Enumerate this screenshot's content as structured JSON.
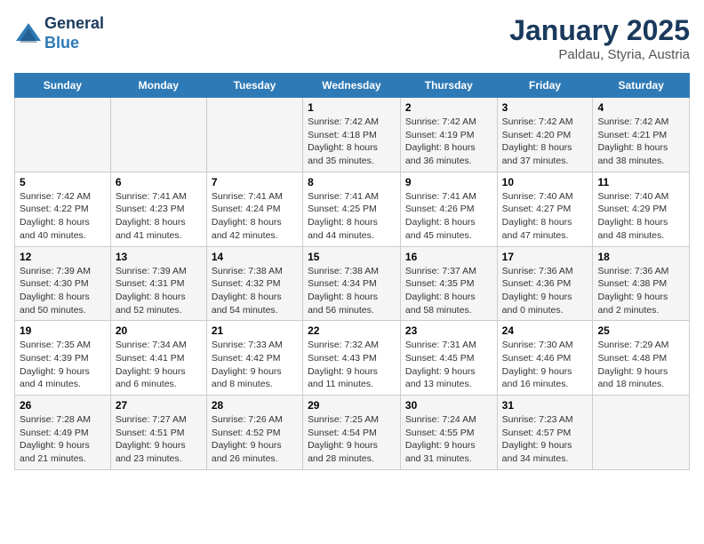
{
  "header": {
    "logo_line1": "General",
    "logo_line2": "Blue",
    "title": "January 2025",
    "subtitle": "Paldau, Styria, Austria"
  },
  "weekdays": [
    "Sunday",
    "Monday",
    "Tuesday",
    "Wednesday",
    "Thursday",
    "Friday",
    "Saturday"
  ],
  "weeks": [
    [
      {
        "day": "",
        "info": ""
      },
      {
        "day": "",
        "info": ""
      },
      {
        "day": "",
        "info": ""
      },
      {
        "day": "1",
        "info": "Sunrise: 7:42 AM\nSunset: 4:18 PM\nDaylight: 8 hours and 35 minutes."
      },
      {
        "day": "2",
        "info": "Sunrise: 7:42 AM\nSunset: 4:19 PM\nDaylight: 8 hours and 36 minutes."
      },
      {
        "day": "3",
        "info": "Sunrise: 7:42 AM\nSunset: 4:20 PM\nDaylight: 8 hours and 37 minutes."
      },
      {
        "day": "4",
        "info": "Sunrise: 7:42 AM\nSunset: 4:21 PM\nDaylight: 8 hours and 38 minutes."
      }
    ],
    [
      {
        "day": "5",
        "info": "Sunrise: 7:42 AM\nSunset: 4:22 PM\nDaylight: 8 hours and 40 minutes."
      },
      {
        "day": "6",
        "info": "Sunrise: 7:41 AM\nSunset: 4:23 PM\nDaylight: 8 hours and 41 minutes."
      },
      {
        "day": "7",
        "info": "Sunrise: 7:41 AM\nSunset: 4:24 PM\nDaylight: 8 hours and 42 minutes."
      },
      {
        "day": "8",
        "info": "Sunrise: 7:41 AM\nSunset: 4:25 PM\nDaylight: 8 hours and 44 minutes."
      },
      {
        "day": "9",
        "info": "Sunrise: 7:41 AM\nSunset: 4:26 PM\nDaylight: 8 hours and 45 minutes."
      },
      {
        "day": "10",
        "info": "Sunrise: 7:40 AM\nSunset: 4:27 PM\nDaylight: 8 hours and 47 minutes."
      },
      {
        "day": "11",
        "info": "Sunrise: 7:40 AM\nSunset: 4:29 PM\nDaylight: 8 hours and 48 minutes."
      }
    ],
    [
      {
        "day": "12",
        "info": "Sunrise: 7:39 AM\nSunset: 4:30 PM\nDaylight: 8 hours and 50 minutes."
      },
      {
        "day": "13",
        "info": "Sunrise: 7:39 AM\nSunset: 4:31 PM\nDaylight: 8 hours and 52 minutes."
      },
      {
        "day": "14",
        "info": "Sunrise: 7:38 AM\nSunset: 4:32 PM\nDaylight: 8 hours and 54 minutes."
      },
      {
        "day": "15",
        "info": "Sunrise: 7:38 AM\nSunset: 4:34 PM\nDaylight: 8 hours and 56 minutes."
      },
      {
        "day": "16",
        "info": "Sunrise: 7:37 AM\nSunset: 4:35 PM\nDaylight: 8 hours and 58 minutes."
      },
      {
        "day": "17",
        "info": "Sunrise: 7:36 AM\nSunset: 4:36 PM\nDaylight: 9 hours and 0 minutes."
      },
      {
        "day": "18",
        "info": "Sunrise: 7:36 AM\nSunset: 4:38 PM\nDaylight: 9 hours and 2 minutes."
      }
    ],
    [
      {
        "day": "19",
        "info": "Sunrise: 7:35 AM\nSunset: 4:39 PM\nDaylight: 9 hours and 4 minutes."
      },
      {
        "day": "20",
        "info": "Sunrise: 7:34 AM\nSunset: 4:41 PM\nDaylight: 9 hours and 6 minutes."
      },
      {
        "day": "21",
        "info": "Sunrise: 7:33 AM\nSunset: 4:42 PM\nDaylight: 9 hours and 8 minutes."
      },
      {
        "day": "22",
        "info": "Sunrise: 7:32 AM\nSunset: 4:43 PM\nDaylight: 9 hours and 11 minutes."
      },
      {
        "day": "23",
        "info": "Sunrise: 7:31 AM\nSunset: 4:45 PM\nDaylight: 9 hours and 13 minutes."
      },
      {
        "day": "24",
        "info": "Sunrise: 7:30 AM\nSunset: 4:46 PM\nDaylight: 9 hours and 16 minutes."
      },
      {
        "day": "25",
        "info": "Sunrise: 7:29 AM\nSunset: 4:48 PM\nDaylight: 9 hours and 18 minutes."
      }
    ],
    [
      {
        "day": "26",
        "info": "Sunrise: 7:28 AM\nSunset: 4:49 PM\nDaylight: 9 hours and 21 minutes."
      },
      {
        "day": "27",
        "info": "Sunrise: 7:27 AM\nSunset: 4:51 PM\nDaylight: 9 hours and 23 minutes."
      },
      {
        "day": "28",
        "info": "Sunrise: 7:26 AM\nSunset: 4:52 PM\nDaylight: 9 hours and 26 minutes."
      },
      {
        "day": "29",
        "info": "Sunrise: 7:25 AM\nSunset: 4:54 PM\nDaylight: 9 hours and 28 minutes."
      },
      {
        "day": "30",
        "info": "Sunrise: 7:24 AM\nSunset: 4:55 PM\nDaylight: 9 hours and 31 minutes."
      },
      {
        "day": "31",
        "info": "Sunrise: 7:23 AM\nSunset: 4:57 PM\nDaylight: 9 hours and 34 minutes."
      },
      {
        "day": "",
        "info": ""
      }
    ]
  ]
}
